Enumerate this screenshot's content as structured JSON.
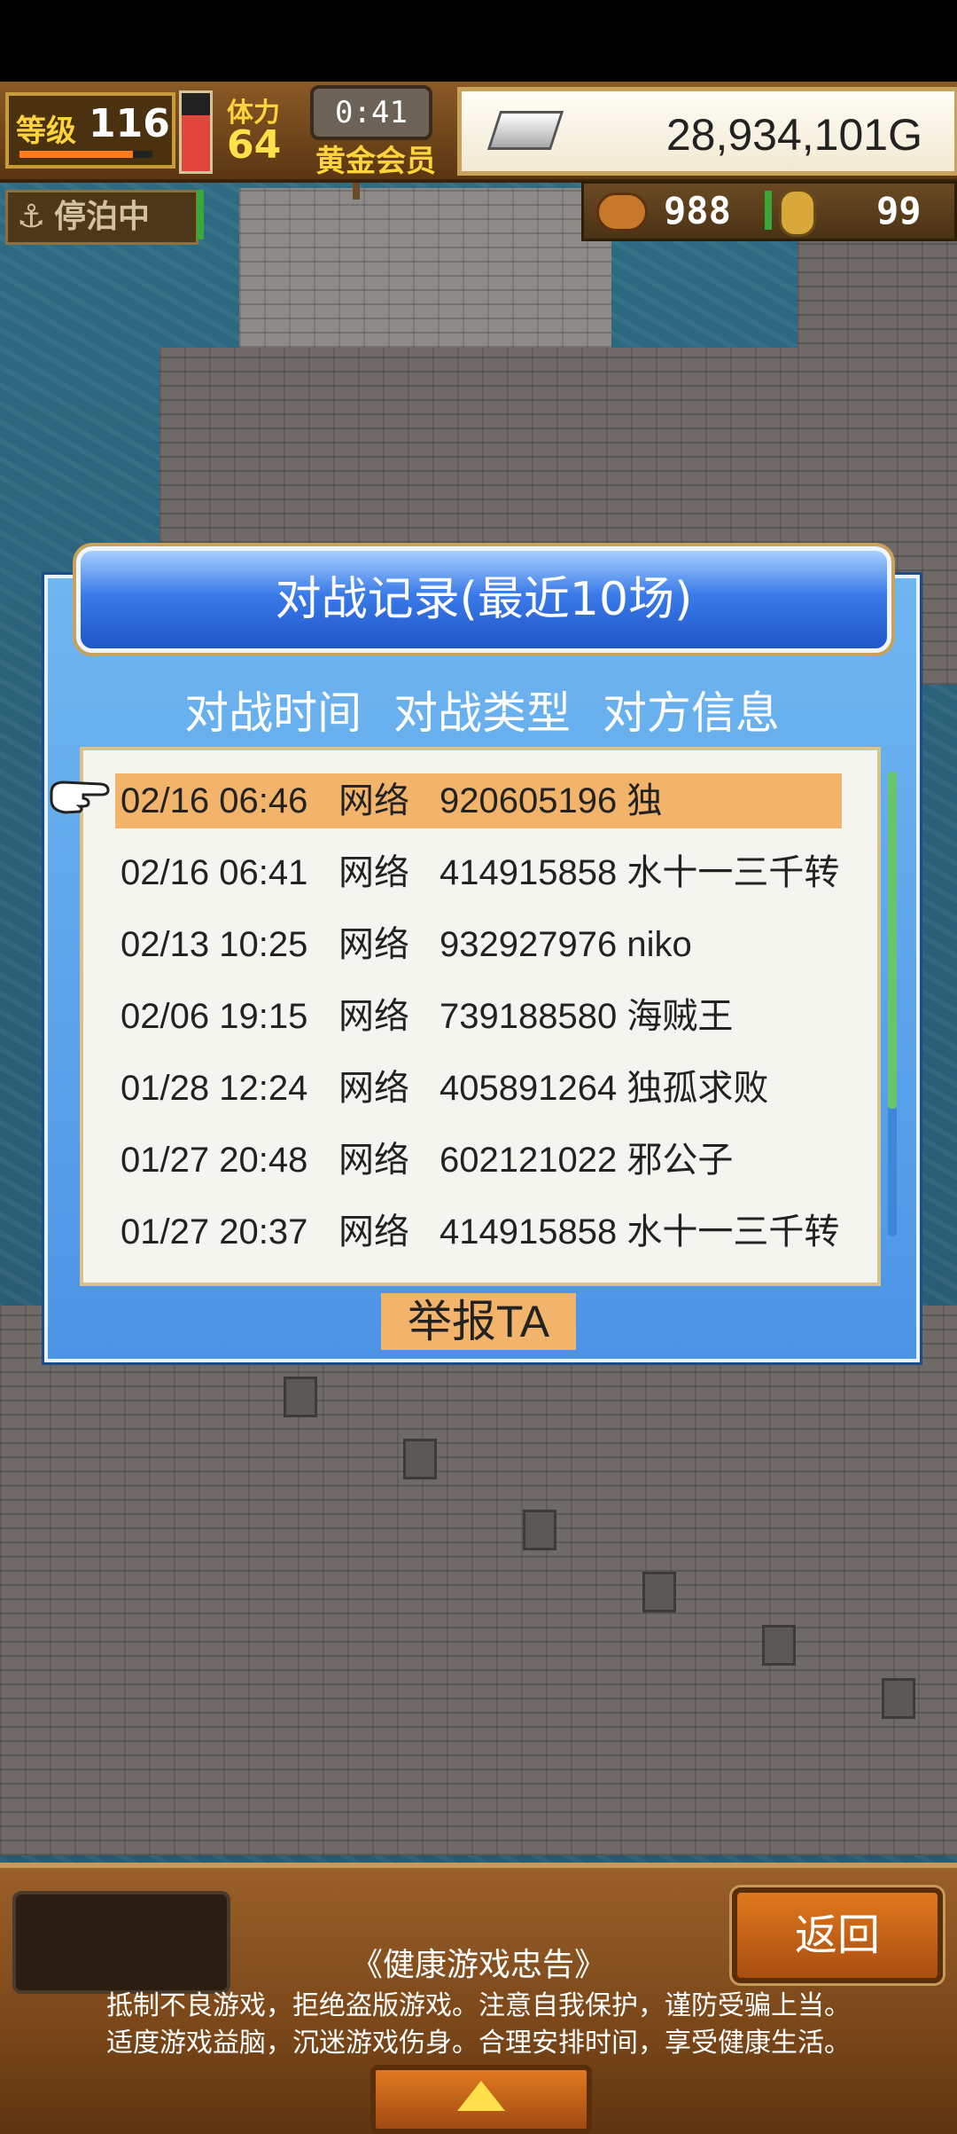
{
  "status": {
    "level_label": "等级",
    "level": "116",
    "level_progress": 0.85,
    "hp_fraction": 0.72,
    "stamina_label": "体力",
    "stamina": "64",
    "timer": "0:41",
    "membership": "黄金会员",
    "money": "28,934,101G",
    "moor_status": "停泊中",
    "resource1": "988",
    "resource2": "99"
  },
  "dialog": {
    "title": "对战记录(最近10场)",
    "headers": [
      "对战时间",
      "对战类型",
      "对方信息"
    ],
    "rows": [
      {
        "time": "02/16 06:46",
        "type": "网络",
        "opponent": "920605196 独"
      },
      {
        "time": "02/16 06:41",
        "type": "网络",
        "opponent": "414915858 水十一三千转"
      },
      {
        "time": "02/13 10:25",
        "type": "网络",
        "opponent": "932927976 niko"
      },
      {
        "time": "02/06 19:15",
        "type": "网络",
        "opponent": "739188580 海贼王"
      },
      {
        "time": "01/28 12:24",
        "type": "网络",
        "opponent": "405891264 独孤求败"
      },
      {
        "time": "01/27 20:48",
        "type": "网络",
        "opponent": "602121022 邪公子"
      },
      {
        "time": "01/27 20:37",
        "type": "网络",
        "opponent": "414915858 水十一三千转"
      }
    ],
    "selected_index": 0,
    "report_button": "举报TA"
  },
  "bottom": {
    "back_button": "返回",
    "notice_title": "《健康游戏忠告》",
    "notice_line1": "抵制不良游戏，拒绝盗版游戏。注意自我保护，谨防受骗上当。",
    "notice_line2": "适度游戏益脑，沉迷游戏伤身。合理安排时间，享受健康生活。"
  },
  "colors": {
    "selected_row": "#f2b36a",
    "dialog_blue": "#4d94e6",
    "header_blue": "#1f56c8"
  }
}
